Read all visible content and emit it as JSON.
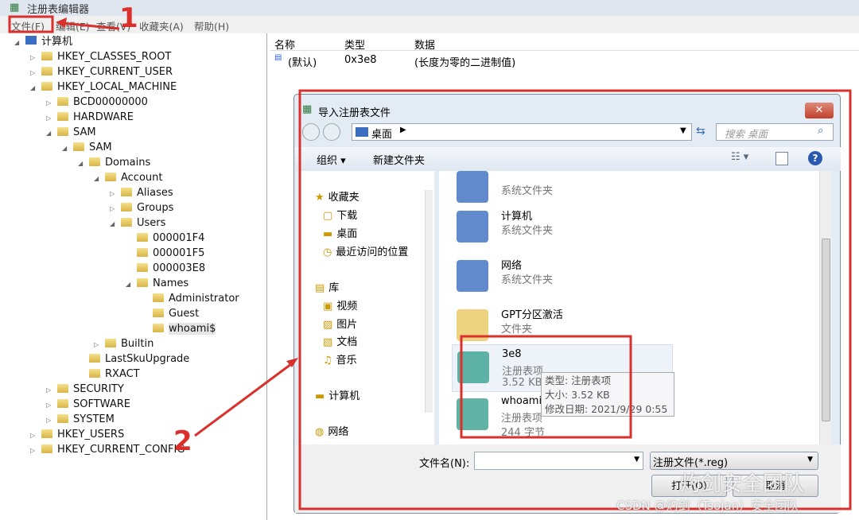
{
  "window": {
    "title": "注册表编辑器"
  },
  "menu": [
    "文件(F)",
    "编辑(E)",
    "查看(V)",
    "收藏夹(A)",
    "帮助(H)"
  ],
  "tree": [
    {
      "label": "计算机",
      "level": 0,
      "arrow": "◢"
    },
    {
      "label": "HKEY_CLASSES_ROOT",
      "level": 1,
      "arrow": "▷"
    },
    {
      "label": "HKEY_CURRENT_USER",
      "level": 1,
      "arrow": "▷"
    },
    {
      "label": "HKEY_LOCAL_MACHINE",
      "level": 1,
      "arrow": "◢"
    },
    {
      "label": "BCD00000000",
      "level": 2,
      "arrow": "▷"
    },
    {
      "label": "HARDWARE",
      "level": 2,
      "arrow": "▷"
    },
    {
      "label": "SAM",
      "level": 2,
      "arrow": "◢"
    },
    {
      "label": "SAM",
      "level": 3,
      "arrow": "◢"
    },
    {
      "label": "Domains",
      "level": 4,
      "arrow": "◢"
    },
    {
      "label": "Account",
      "level": 5,
      "arrow": "◢"
    },
    {
      "label": "Aliases",
      "level": 6,
      "arrow": "▷"
    },
    {
      "label": "Groups",
      "level": 6,
      "arrow": "▷"
    },
    {
      "label": "Users",
      "level": 6,
      "arrow": "◢"
    },
    {
      "label": "000001F4",
      "level": 7,
      "arrow": ""
    },
    {
      "label": "000001F5",
      "level": 7,
      "arrow": ""
    },
    {
      "label": "000003E8",
      "level": 7,
      "arrow": ""
    },
    {
      "label": "Names",
      "level": 7,
      "arrow": "◢"
    },
    {
      "label": "Administrator",
      "level": 8,
      "arrow": ""
    },
    {
      "label": "Guest",
      "level": 8,
      "arrow": ""
    },
    {
      "label": "whoami$",
      "level": 8,
      "arrow": "",
      "selected": true
    },
    {
      "label": "Builtin",
      "level": 5,
      "arrow": "▷"
    },
    {
      "label": "LastSkuUpgrade",
      "level": 4,
      "arrow": ""
    },
    {
      "label": "RXACT",
      "level": 4,
      "arrow": ""
    },
    {
      "label": "SECURITY",
      "level": 2,
      "arrow": "▷"
    },
    {
      "label": "SOFTWARE",
      "level": 2,
      "arrow": "▷"
    },
    {
      "label": "SYSTEM",
      "level": 2,
      "arrow": "▷"
    },
    {
      "label": "HKEY_USERS",
      "level": 1,
      "arrow": "▷"
    },
    {
      "label": "HKEY_CURRENT_CONFIG",
      "level": 1,
      "arrow": "▷"
    }
  ],
  "values": {
    "headers": [
      "名称",
      "类型",
      "数据"
    ],
    "rows": [
      [
        "(默认)",
        "0x3e8",
        "(长度为零的二进制值)"
      ]
    ]
  },
  "dialog": {
    "title": "导入注册表文件",
    "close": "✕",
    "address": "桌面",
    "search_placeholder": "搜索 桌面",
    "toolbar": {
      "organize": "组织 ▾",
      "new_folder": "新建文件夹"
    },
    "nav": [
      "收藏夹",
      "下载",
      "桌面",
      "最近访问的位置",
      "库",
      "视频",
      "图片",
      "文档",
      "音乐",
      "计算机",
      "网络"
    ],
    "files": [
      {
        "name": "",
        "sub": "系统文件夹"
      },
      {
        "name": "计算机",
        "sub": "系统文件夹"
      },
      {
        "name": "网络",
        "sub": "系统文件夹"
      },
      {
        "name": "GPT分区激活",
        "sub": "文件夹"
      },
      {
        "name": "3e8",
        "sub": "注册表项",
        "size": "3.52 KB"
      },
      {
        "name": "whoami",
        "sub": "注册表项",
        "size": "244 字节"
      }
    ],
    "tooltip": [
      "类型: 注册表项",
      "大小: 3.52 KB",
      "修改日期: 2021/9/29 0:55"
    ],
    "filename_label": "文件名(N):",
    "filename_value": "",
    "filter": "注册文件(*.reg)",
    "open": "打开(O)",
    "cancel": "取消"
  },
  "annotations": {
    "step1": "1",
    "step2": "2",
    "color": "#d9302c"
  },
  "watermark": {
    "line1": "灼剑安全团队",
    "line2": "CSDN @灼剑（Tsojan）安全团队"
  }
}
